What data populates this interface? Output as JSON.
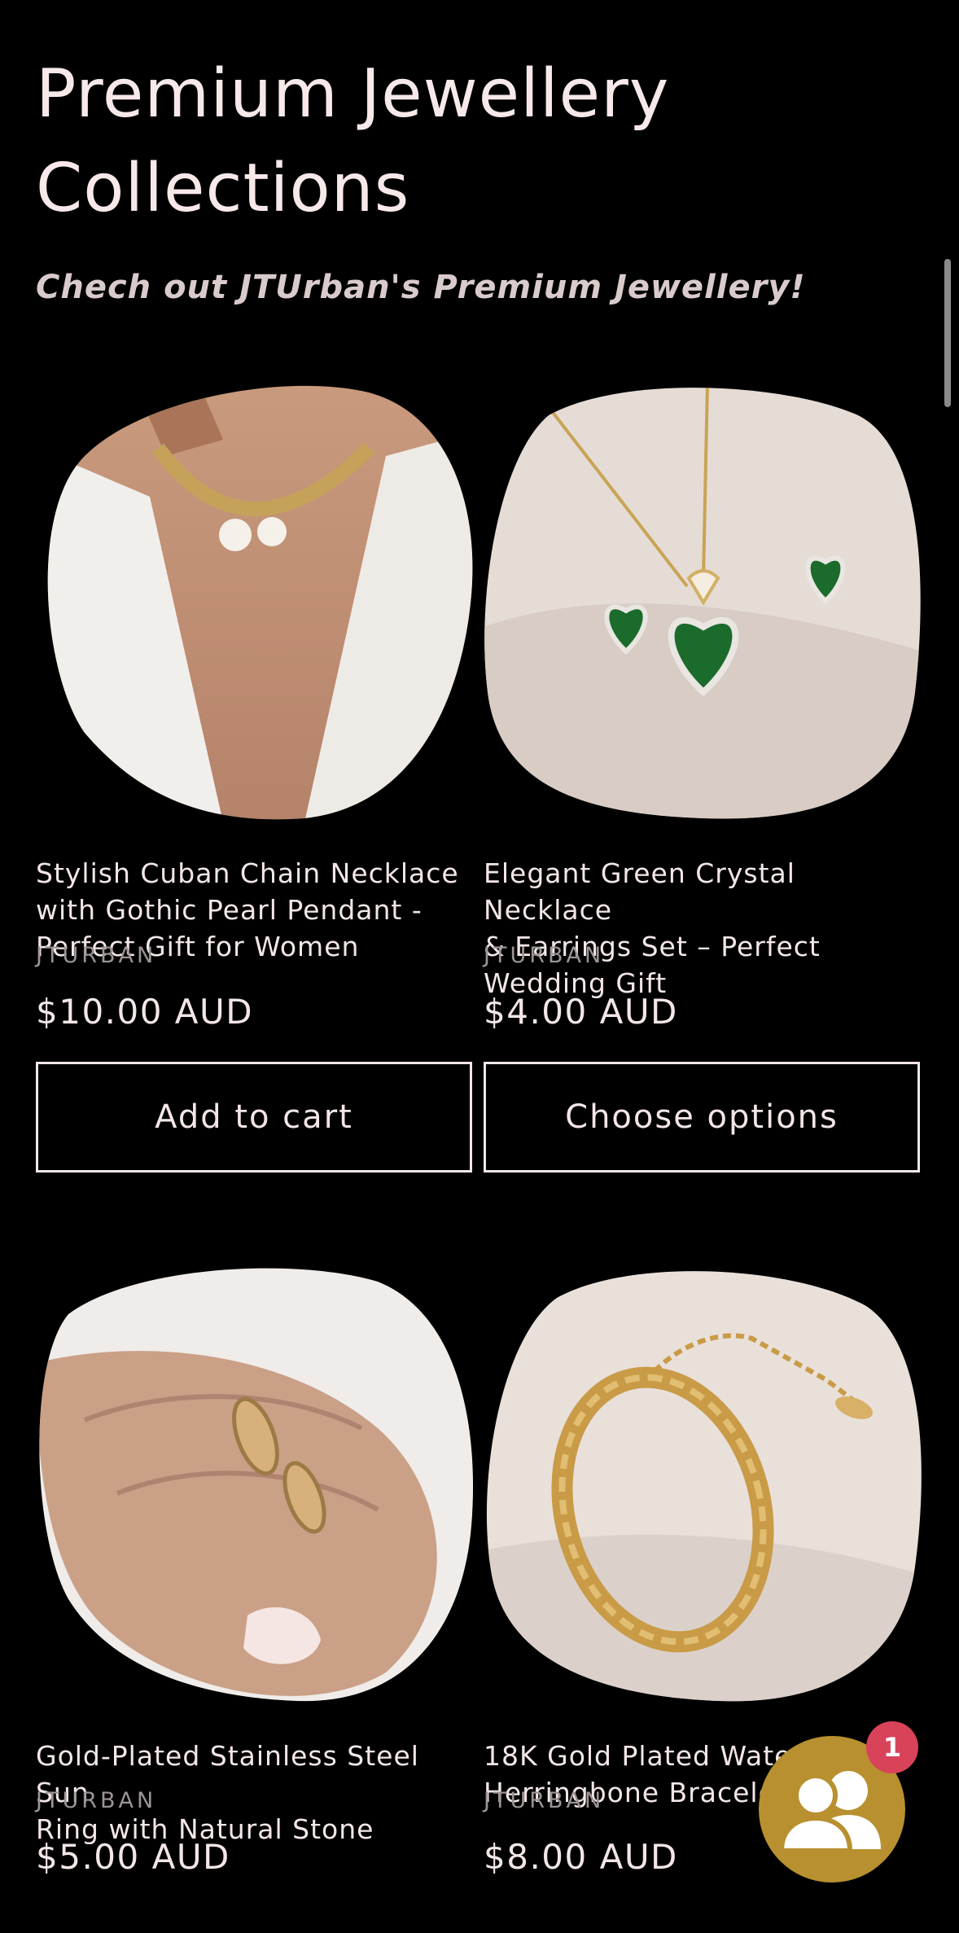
{
  "section": {
    "title": "Premium Jewellery Collections",
    "subtitle": "Chech out JTUrban's Premium Jewellery!"
  },
  "products": [
    {
      "title_lines": [
        "Stylish Cuban Chain Necklace",
        "with Gothic Pearl Pendant -",
        "Perfect Gift for Women"
      ],
      "vendor": "JTURBAN",
      "price": "$10.00 AUD",
      "button": "Add to cart",
      "image_icon": "pearl-chain-necklace-photo"
    },
    {
      "title_lines": [
        "Elegant Green Crystal Necklace",
        "& Earrings Set – Perfect",
        "Wedding Gift"
      ],
      "vendor": "JTURBAN",
      "price": "$4.00 AUD",
      "button": "Choose options",
      "image_icon": "green-crystal-necklace-photo"
    },
    {
      "title_lines": [
        "Gold-Plated Stainless Steel Sun",
        "Ring with Natural Stone"
      ],
      "vendor": "JTURBAN",
      "price": "$5.00 AUD",
      "image_icon": "gold-rings-hand-photo"
    },
    {
      "title_lines": [
        "18K Gold Plated Water",
        "Herringbone Bracele"
      ],
      "vendor": "JTURBAN",
      "price": "$8.00 AUD",
      "image_icon": "herringbone-bracelet-photo"
    }
  ],
  "chat_widget": {
    "icon": "community-chat-icon",
    "badge_count": "1"
  },
  "colors": {
    "background": "#000000",
    "text": "#f3e6e6",
    "muted": "#9c9494",
    "chat_gold": "#b8902f",
    "badge_red": "#d9435a"
  }
}
